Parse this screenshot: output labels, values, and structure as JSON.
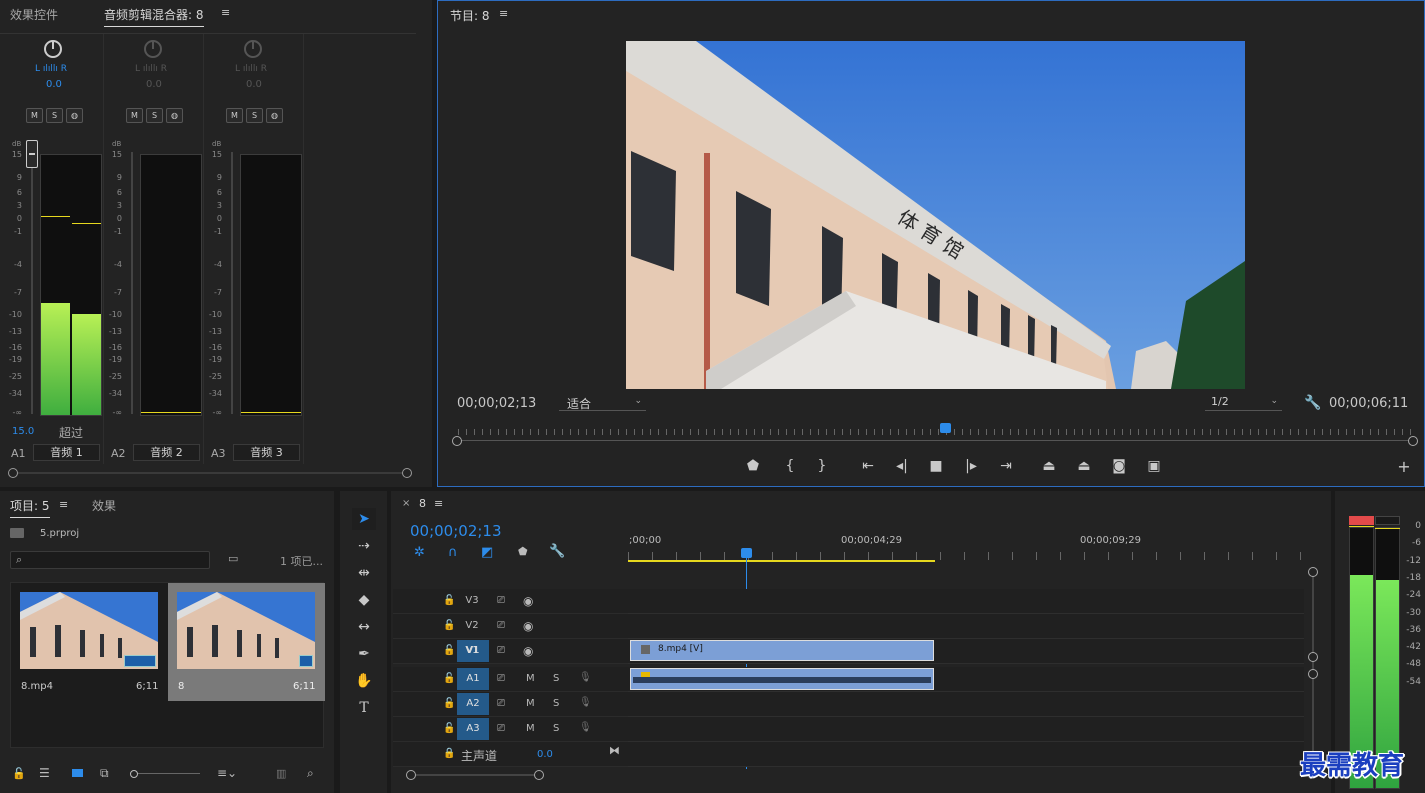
{
  "mixer": {
    "tab_effects": "效果控件",
    "tab_mixer": "音频剪辑混合器: 8",
    "channels": [
      {
        "lr": "L ılıllı R",
        "value": "0.0",
        "m": "M",
        "s": "S",
        "id": "A1",
        "name": "音频 1"
      },
      {
        "lr": "L ılıllı R",
        "value": "0.0",
        "m": "M",
        "s": "S",
        "id": "A2",
        "name": "音频 2"
      },
      {
        "lr": "L ılıllı R",
        "value": "0.0",
        "m": "M",
        "s": "S",
        "id": "A3",
        "name": "音频 3"
      }
    ],
    "db_label": "dB",
    "scale": [
      "15",
      "9",
      "6",
      "3",
      "0",
      "-1",
      "-4",
      "-7",
      "-10",
      "-13",
      "-16",
      "-19",
      "-25",
      "-34",
      "-∞"
    ],
    "peak_value": "15.0",
    "peak_label": "超过",
    "levels": {
      "a1_left": 0.43,
      "a1_right": 0.39
    }
  },
  "program": {
    "title": "节目: 8",
    "timecode": "00;00;02;13",
    "fit": "适合",
    "resolution": "1/2",
    "duration": "00;00;06;11",
    "playhead": 0.51,
    "building_text": "体 育 馆"
  },
  "project": {
    "tab_project": "项目: 5",
    "tab_effects": "效果",
    "file": "5.prproj",
    "search_placeholder": "",
    "count": "1 项已...",
    "items": [
      {
        "name": "8.mp4",
        "duration": "6;11"
      },
      {
        "name": "8",
        "duration": "6;11"
      }
    ]
  },
  "timeline": {
    "close": "×",
    "tab": "8",
    "timecode": "00;00;02;13",
    "ruler": [
      ";00;00",
      "00;00;04;29",
      "00;00;09;29"
    ],
    "video_tracks": [
      {
        "id": "V3",
        "src": ""
      },
      {
        "id": "V2",
        "src": ""
      },
      {
        "id": "V1",
        "src": "V1"
      }
    ],
    "audio_tracks": [
      {
        "id": "A1",
        "src": "A1",
        "m": "M",
        "s": "S"
      },
      {
        "id": "A2",
        "src": "A2",
        "m": "M",
        "s": "S"
      },
      {
        "id": "A3",
        "src": "A3",
        "m": "M",
        "s": "S"
      }
    ],
    "clip_video": "8.mp4 [V]",
    "master_label": "主声道",
    "master_value": "0.0"
  },
  "right_meter": {
    "scale": [
      "0",
      "-6",
      "-12",
      "-18",
      "-24",
      "-30",
      "-36",
      "-42",
      "-48",
      "-54"
    ],
    "left_level": 0.82,
    "right_level": 0.8
  },
  "watermark": "最需教育",
  "colors": {
    "accent": "#2d8ceb",
    "green": "#39d353",
    "clip_blue": "#7c9fd6",
    "yellow": "#e6d81e"
  }
}
